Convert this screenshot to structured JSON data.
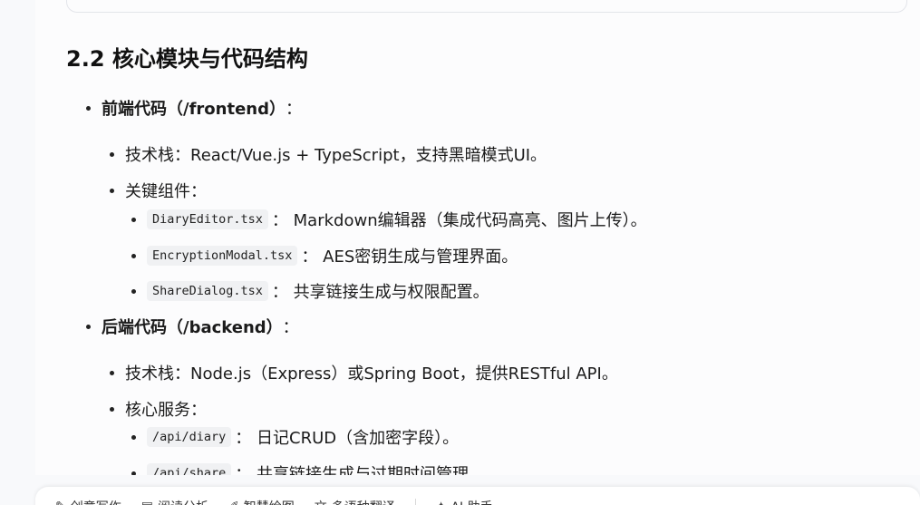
{
  "section": {
    "heading": "2.2 核心模块与代码结构",
    "frontend": {
      "title": "前端代码（/frontend）",
      "colon": "：",
      "tech_stack": "技术栈：React/Vue.js + TypeScript，支持黑暗模式UI。",
      "components_label": "关键组件：",
      "components": [
        {
          "code": "DiaryEditor.tsx",
          "desc": "： Markdown编辑器（集成代码高亮、图片上传）。"
        },
        {
          "code": "EncryptionModal.tsx",
          "desc": "： AES密钥生成与管理界面。"
        },
        {
          "code": "ShareDialog.tsx",
          "desc": "： 共享链接生成与权限配置。"
        }
      ]
    },
    "backend": {
      "title": "后端代码（/backend）",
      "colon": "：",
      "tech_stack": "技术栈：Node.js（Express）或Spring Boot，提供RESTful API。",
      "services_label": "核心服务：",
      "services": [
        {
          "code": "/api/diary",
          "desc": "： 日记CRUD（含加密字段）。"
        },
        {
          "code": "/api/share",
          "desc": "： 共享链接生成与过期时间管理。"
        }
      ]
    }
  },
  "toolbar": {
    "items": [
      {
        "label": "创意写作",
        "icon": "pen-icon"
      },
      {
        "label": "阅读分析",
        "icon": "document-icon"
      },
      {
        "label": "智慧绘图",
        "icon": "brush-icon"
      },
      {
        "label": "多语种翻译",
        "icon": "translate-icon"
      }
    ],
    "extra_label": "AI 助手"
  }
}
